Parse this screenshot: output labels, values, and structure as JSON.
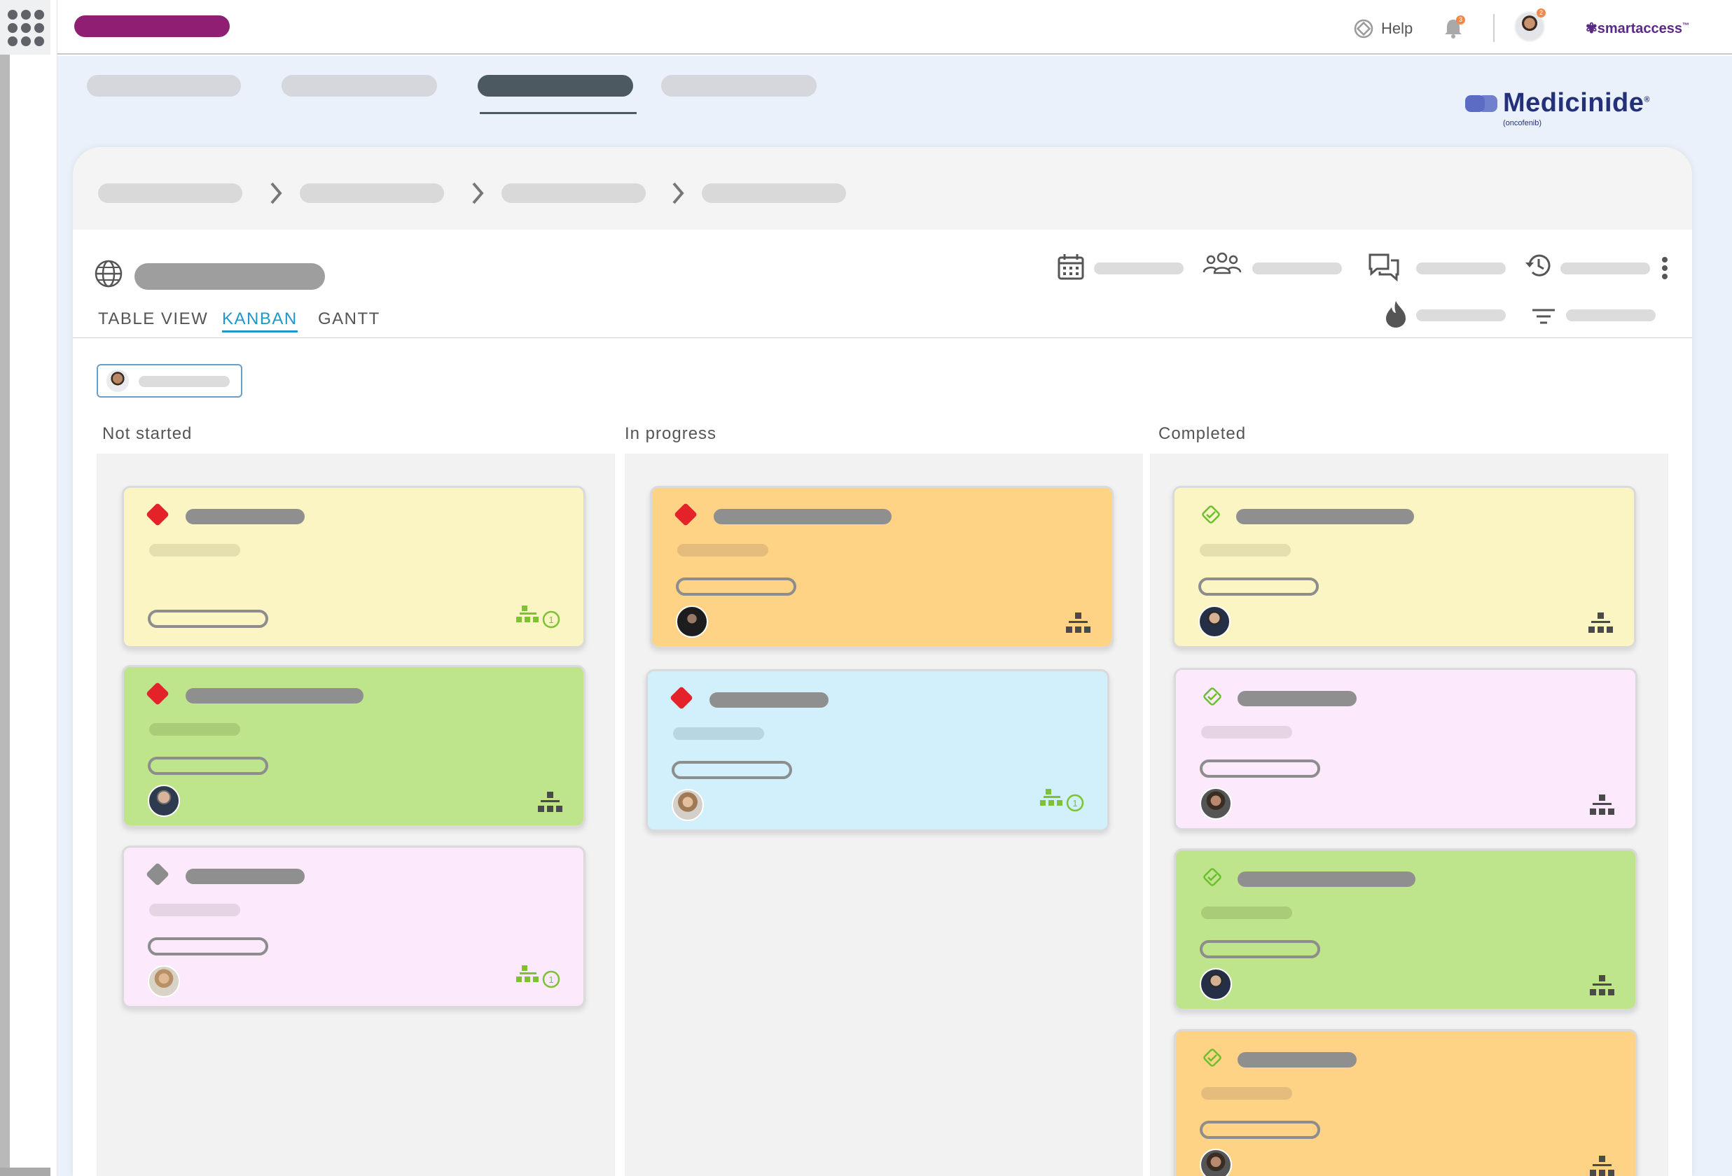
{
  "topbar": {
    "help_label": "Help",
    "notifications_count": "3",
    "profile_badge": "2",
    "brand_name": "smartaccess",
    "brand_tm": "™"
  },
  "product_logo": {
    "name": "Medicinide",
    "registered": "®",
    "generic": "(oncofenib)"
  },
  "view_tabs": [
    {
      "label": "TABLE VIEW",
      "active": false
    },
    {
      "label": "KANBAN",
      "active": true
    },
    {
      "label": "GANTT",
      "active": false
    }
  ],
  "columns": [
    {
      "title": "Not started",
      "cards": [
        {
          "color": "#fbf5c4",
          "priority": "high",
          "has_avatar": false,
          "subtasks": "1"
        },
        {
          "color": "#bfe58c",
          "priority": "high",
          "has_avatar": true,
          "subtasks": ""
        },
        {
          "color": "#fce9fb",
          "priority": "low",
          "has_avatar": true,
          "subtasks": "1"
        }
      ]
    },
    {
      "title": "In progress",
      "cards": [
        {
          "color": "#fed386",
          "priority": "high",
          "has_avatar": true,
          "subtasks": ""
        },
        {
          "color": "#d2f0fc",
          "priority": "high",
          "has_avatar": true,
          "subtasks": "1"
        }
      ]
    },
    {
      "title": "Completed",
      "cards": [
        {
          "color": "#fbf5c4",
          "status": "done",
          "has_avatar": true,
          "subtasks": ""
        },
        {
          "color": "#fce9fb",
          "status": "done",
          "has_avatar": true,
          "subtasks": ""
        },
        {
          "color": "#bfe58c",
          "status": "done",
          "has_avatar": true,
          "subtasks": ""
        },
        {
          "color": "#fed386",
          "status": "done",
          "has_avatar": true,
          "subtasks": ""
        }
      ]
    }
  ],
  "icons": {
    "apps": "apps-grid-icon",
    "help": "help-lifebuoy-icon",
    "notifications": "bell-icon",
    "globe": "globe-icon",
    "calendar": "calendar-icon",
    "team": "team-icon",
    "comments": "comments-icon",
    "history": "history-icon",
    "more": "more-vertical-icon",
    "priority": "flame-icon",
    "filter": "filter-icon",
    "subtasks": "hierarchy-icon",
    "done": "check-diamond-icon"
  },
  "colors": {
    "accent": "#1d98c9",
    "brand_pill": "#8e1f72",
    "priority_high": "#e3222a",
    "priority_low": "#8d8d8d",
    "done_check": "#6bbf2d"
  }
}
